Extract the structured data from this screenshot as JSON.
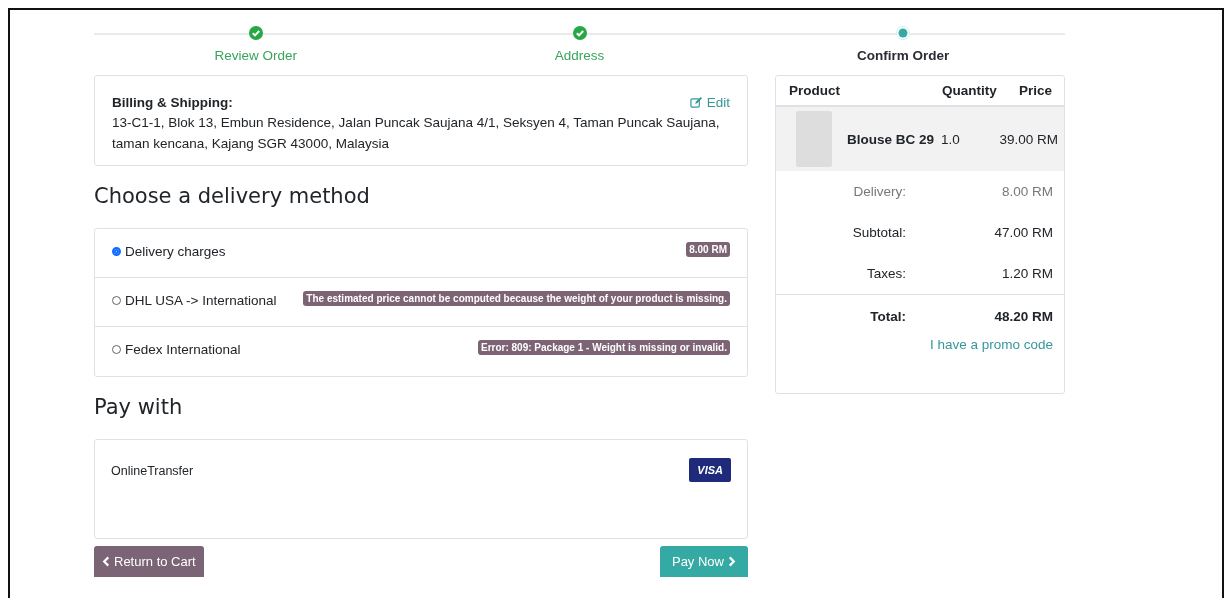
{
  "steps": [
    {
      "label": "Review Order",
      "done": true
    },
    {
      "label": "Address",
      "done": true
    },
    {
      "label": "Confirm Order",
      "done": false
    }
  ],
  "address": {
    "title": "Billing & Shipping:",
    "edit": "Edit",
    "text": "13-C1-1, Blok 13, Embun Residence, Jalan Puncak Saujana 4/1, Seksyen 4, Taman Puncak Saujana, taman kencana, Kajang SGR 43000, Malaysia"
  },
  "delivery": {
    "heading": "Choose a delivery method",
    "methods": [
      {
        "name": "Delivery charges",
        "badge": "8.00 RM",
        "selected": true
      },
      {
        "name": "DHL USA -> International",
        "badge": "The estimated price cannot be computed because the weight of your product is missing.",
        "selected": false
      },
      {
        "name": "Fedex International",
        "badge": "Error: 809: Package 1 - Weight is missing or invalid.",
        "selected": false
      }
    ]
  },
  "payment": {
    "heading": "Pay with",
    "method": "OnlineTransfer",
    "card": "VISA"
  },
  "buttons": {
    "back": "Return to Cart",
    "pay": "Pay Now"
  },
  "summary": {
    "columns": [
      "Product",
      "Quantity",
      "Price"
    ],
    "items": [
      {
        "name": "Blouse BC 29",
        "quantity": "1.0",
        "price": "39.00 RM"
      }
    ],
    "lines": [
      {
        "label": "Delivery:",
        "value": "8.00 RM",
        "kind": "muted"
      },
      {
        "label": "Subtotal:",
        "value": "47.00 RM",
        "kind": "normal"
      },
      {
        "label": "Taxes:",
        "value": "1.20 RM",
        "kind": "normal"
      },
      {
        "label": "Total:",
        "value": "48.20 RM",
        "kind": "total"
      }
    ],
    "promo": "I have a promo code"
  }
}
